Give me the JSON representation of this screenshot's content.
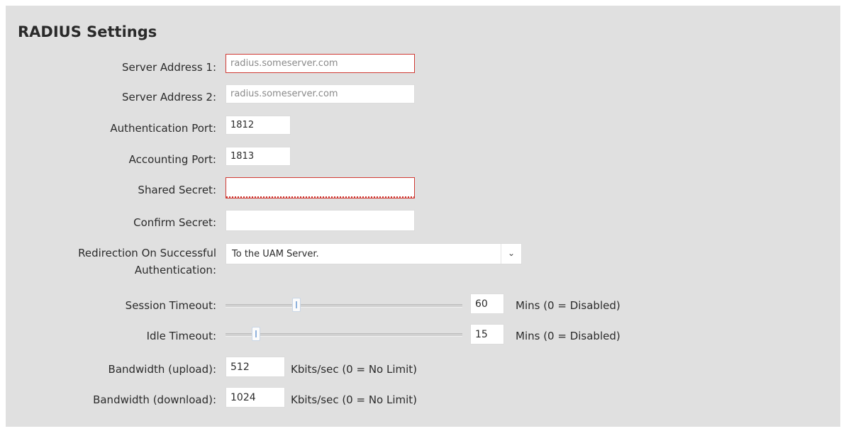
{
  "title": "RADIUS Settings",
  "server1": {
    "label": "Server Address 1:",
    "placeholder": "radius.someserver.com",
    "value": ""
  },
  "server2": {
    "label": "Server Address 2:",
    "placeholder": "radius.someserver.com",
    "value": ""
  },
  "auth_port": {
    "label": "Authentication Port:",
    "value": "1812"
  },
  "acct_port": {
    "label": "Accounting Port:",
    "value": "1813"
  },
  "shared_secret": {
    "label": "Shared Secret:",
    "value": ""
  },
  "confirm_secret": {
    "label": "Confirm Secret:",
    "value": ""
  },
  "redirection": {
    "label_line1": "Redirection On Successful",
    "label_line2": "Authentication:",
    "selected": "To the UAM Server.",
    "arrow_icon": "chevron-down-icon"
  },
  "session_timeout": {
    "label": "Session Timeout:",
    "value": "60",
    "unit": "Mins (0 = Disabled)",
    "slider_fraction": 0.3
  },
  "idle_timeout": {
    "label": "Idle Timeout:",
    "value": "15",
    "unit": "Mins (0 = Disabled)",
    "slider_fraction": 0.13
  },
  "bw_upload": {
    "label": "Bandwidth (upload):",
    "value": "512",
    "unit": "Kbits/sec (0 = No Limit)"
  },
  "bw_download": {
    "label": "Bandwidth (download):",
    "value": "1024",
    "unit": "Kbits/sec (0 = No Limit)"
  },
  "colors": {
    "error_border": "#d03a34",
    "slider_handle_accent": "#8fb2dd",
    "panel_bg": "#e0e0e0"
  }
}
